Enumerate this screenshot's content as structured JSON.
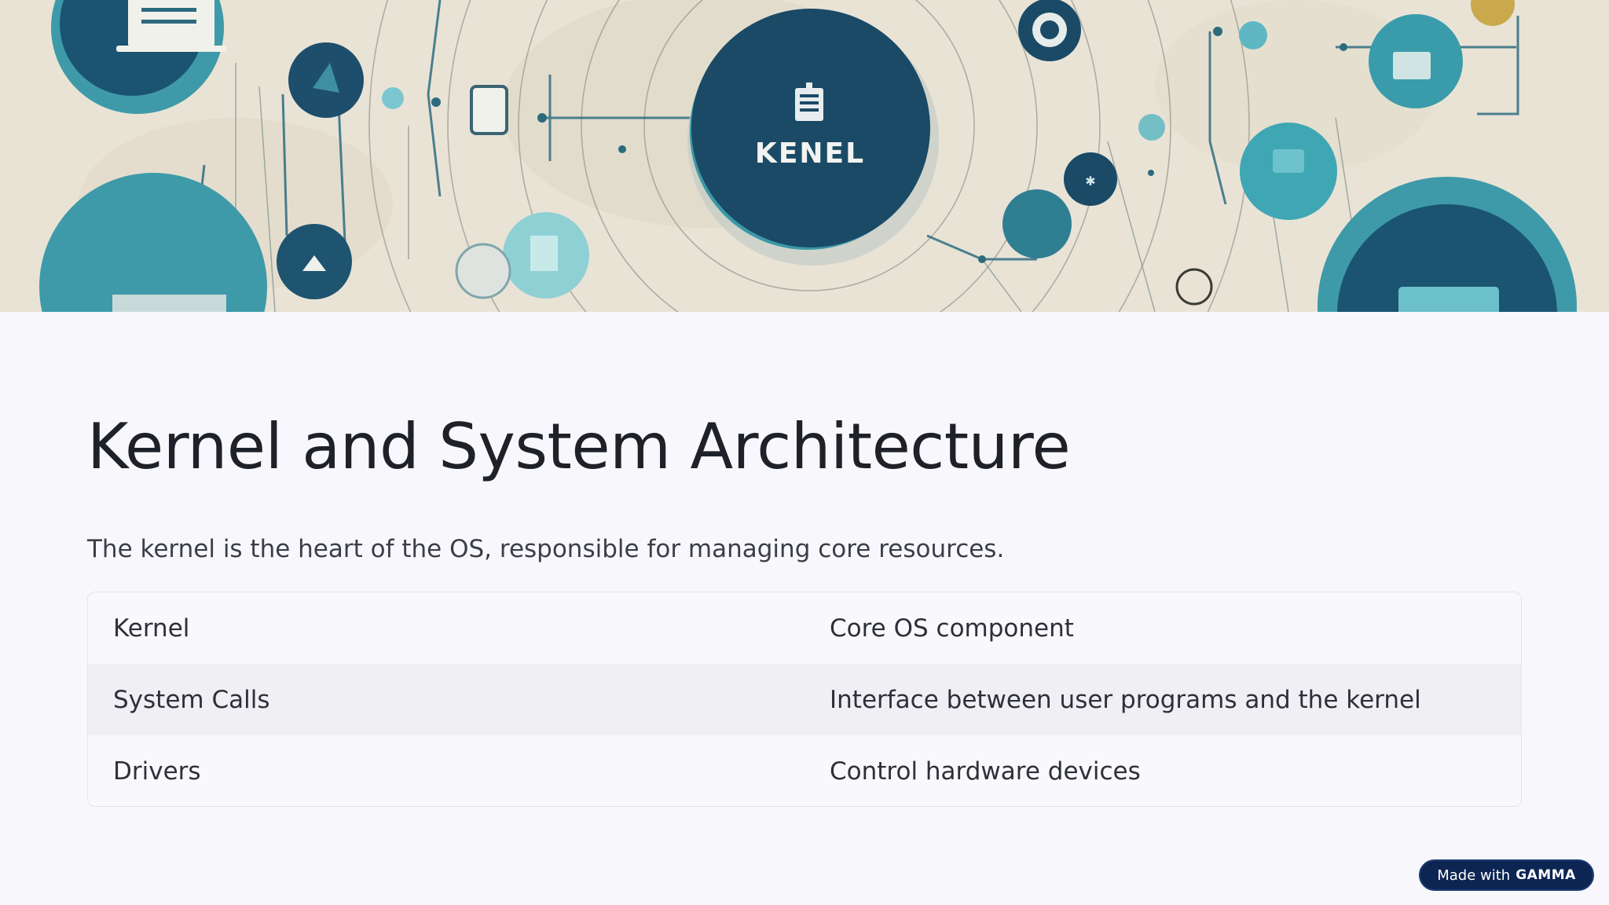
{
  "hero": {
    "kernel_label": "KENEL"
  },
  "slide": {
    "title": "Kernel and System Architecture",
    "subtitle": "The kernel is the heart of the OS, responsible for managing core resources."
  },
  "table": {
    "rows": [
      {
        "term": "Kernel",
        "description": "Core OS component"
      },
      {
        "term": "System Calls",
        "description": "Interface between user programs and the kernel"
      },
      {
        "term": "Drivers",
        "description": "Control hardware devices"
      }
    ]
  },
  "badge": {
    "prefix": "Made with",
    "brand": "GAMMA"
  },
  "colors": {
    "hero_background": "#e9e3d6",
    "accent_dark_teal": "#1b4f6e",
    "accent_teal": "#3e9aa8",
    "accent_light_teal": "#7cc7cf",
    "badge_background": "#0d2553"
  }
}
